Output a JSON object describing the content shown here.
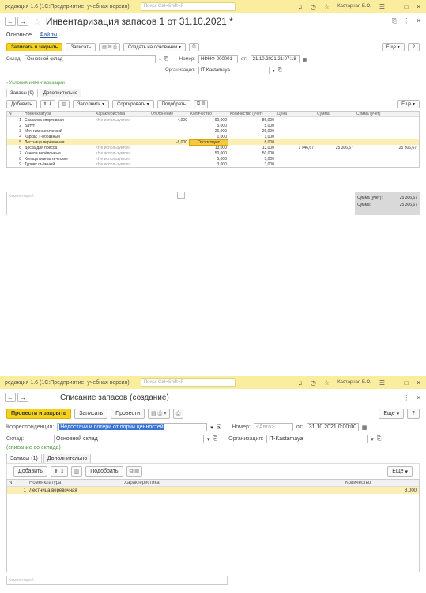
{
  "win1": {
    "app_title": "редакция 1.6  (1С:Предприятие, учебная версия)",
    "search_placeholder": "Поиск Ctrl+Shift+F",
    "user": "Кастарная Е.О.",
    "doc_title": "Инвентаризация запасов 1 от 31.10.2021 *",
    "tabs": {
      "main": "Основное",
      "files": "Файлы"
    },
    "toolbar": {
      "save_close": "Записать и закрыть",
      "save": "Записать",
      "create_based": "Создать на основании",
      "more": "Еще",
      "help": "?"
    },
    "form": {
      "warehouse_label": "Склад:",
      "warehouse_value": "Основной склад",
      "number_label": "Номер:",
      "number_value": "НФНФ-000001",
      "date_label": "от:",
      "date_value": "31.10.2021 21:07:18",
      "org_label": "Организация:",
      "org_value": "IT-Kastamaya",
      "conditions_link": "Условия инвентаризации"
    },
    "inner_tabs": {
      "stock": "Запасы (9)",
      "extra": "Дополнительно"
    },
    "table_toolbar": {
      "add": "Добавить",
      "fill": "Заполнить",
      "sort": "Сортировать",
      "pick": "Подобрать",
      "more": "Еще"
    },
    "columns": [
      "N",
      "Номенклатура",
      "Характеристика",
      "Отклонение",
      "Количество",
      "Количество (учет)",
      "Цена",
      "Сумма",
      "Сумма (учет)"
    ],
    "rows": [
      {
        "n": "1",
        "name": "Скакалка спортивная",
        "char": "<Не используется>",
        "dev": "4,000",
        "qty": "90,000",
        "qty_acc": "86,000",
        "price": "",
        "sum": "",
        "sum_acc": ""
      },
      {
        "n": "2",
        "name": "Батут",
        "char": "",
        "dev": "",
        "qty": "5,000",
        "qty_acc": "5,000",
        "price": "",
        "sum": "",
        "sum_acc": ""
      },
      {
        "n": "3",
        "name": "Мяч гимнастический",
        "char": "",
        "dev": "",
        "qty": "26,000",
        "qty_acc": "26,000",
        "price": "",
        "sum": "",
        "sum_acc": ""
      },
      {
        "n": "4",
        "name": "Каркас Т-образный",
        "char": "",
        "dev": "",
        "qty": "1,000",
        "qty_acc": "1,000",
        "price": "",
        "sum": "",
        "sum_acc": ""
      },
      {
        "n": "5",
        "name": "Лестница верёвочная",
        "char": "",
        "dev": "-8,000",
        "qty": "Отсутствует",
        "qty_acc": "8,000",
        "price": "",
        "sum": "",
        "sum_acc": ""
      },
      {
        "n": "6",
        "name": "Доска для пресса",
        "char": "<Не используется>",
        "dev": "",
        "qty": "13,000",
        "qty_acc": "13,000",
        "price": "1 946,67",
        "sum": "25 306,67",
        "sum_acc": "25 306,67"
      },
      {
        "n": "7",
        "name": "Качели верёвочные",
        "char": "<Не используется>",
        "dev": "",
        "qty": "50,000",
        "qty_acc": "50,000",
        "price": "",
        "sum": "",
        "sum_acc": ""
      },
      {
        "n": "8",
        "name": "Кольца гимнастические",
        "char": "<Не используется>",
        "dev": "",
        "qty": "5,000",
        "qty_acc": "5,000",
        "price": "",
        "sum": "",
        "sum_acc": ""
      },
      {
        "n": "9",
        "name": "Турник съёмный",
        "char": "<Не используется>",
        "dev": "",
        "qty": "3,000",
        "qty_acc": "3,000",
        "price": "",
        "sum": "",
        "sum_acc": ""
      }
    ],
    "comment_placeholder": "Комментарий",
    "sums": {
      "acc_label": "Сумма (учет):",
      "acc_value": "25 306,67",
      "sum_label": "Сумма:",
      "sum_value": "25 306,67"
    }
  },
  "win2": {
    "app_title": "редакция 1.6  (1С:Предприятие, учебная версия)",
    "search_placeholder": "Поиск Ctrl+Shift+F",
    "user": "Кастарная Е.О.",
    "doc_title": "Списание запасов (создание)",
    "toolbar": {
      "post_close": "Провести и закрыть",
      "save": "Записать",
      "post": "Провести",
      "more": "Еще",
      "help": "?"
    },
    "form": {
      "corr_label": "Корреспонденция:",
      "corr_value": "Недостачи и потери от порчи ценностей",
      "number_label": "Номер:",
      "number_placeholder": "<Авто>",
      "date_label": "от:",
      "date_value": "31.10.2021  0:00:00",
      "warehouse_label": "Склад:",
      "warehouse_value": "Основной склад",
      "org_label": "Организация:",
      "org_value": "IT-Kastamaya",
      "note": "(списание со склада)"
    },
    "inner_tabs": {
      "stock": "Запасы (1)",
      "extra": "Дополнительно"
    },
    "table_toolbar": {
      "add": "Добавить",
      "pick": "Подобрать",
      "more": "Еще"
    },
    "columns": [
      "N",
      "Номенклатура",
      "Характеристика",
      "Количество"
    ],
    "rows": [
      {
        "n": "1",
        "name": "Лестница верёвочная",
        "char": "",
        "qty": "8,000"
      }
    ],
    "comment_placeholder": "Комментарий"
  }
}
